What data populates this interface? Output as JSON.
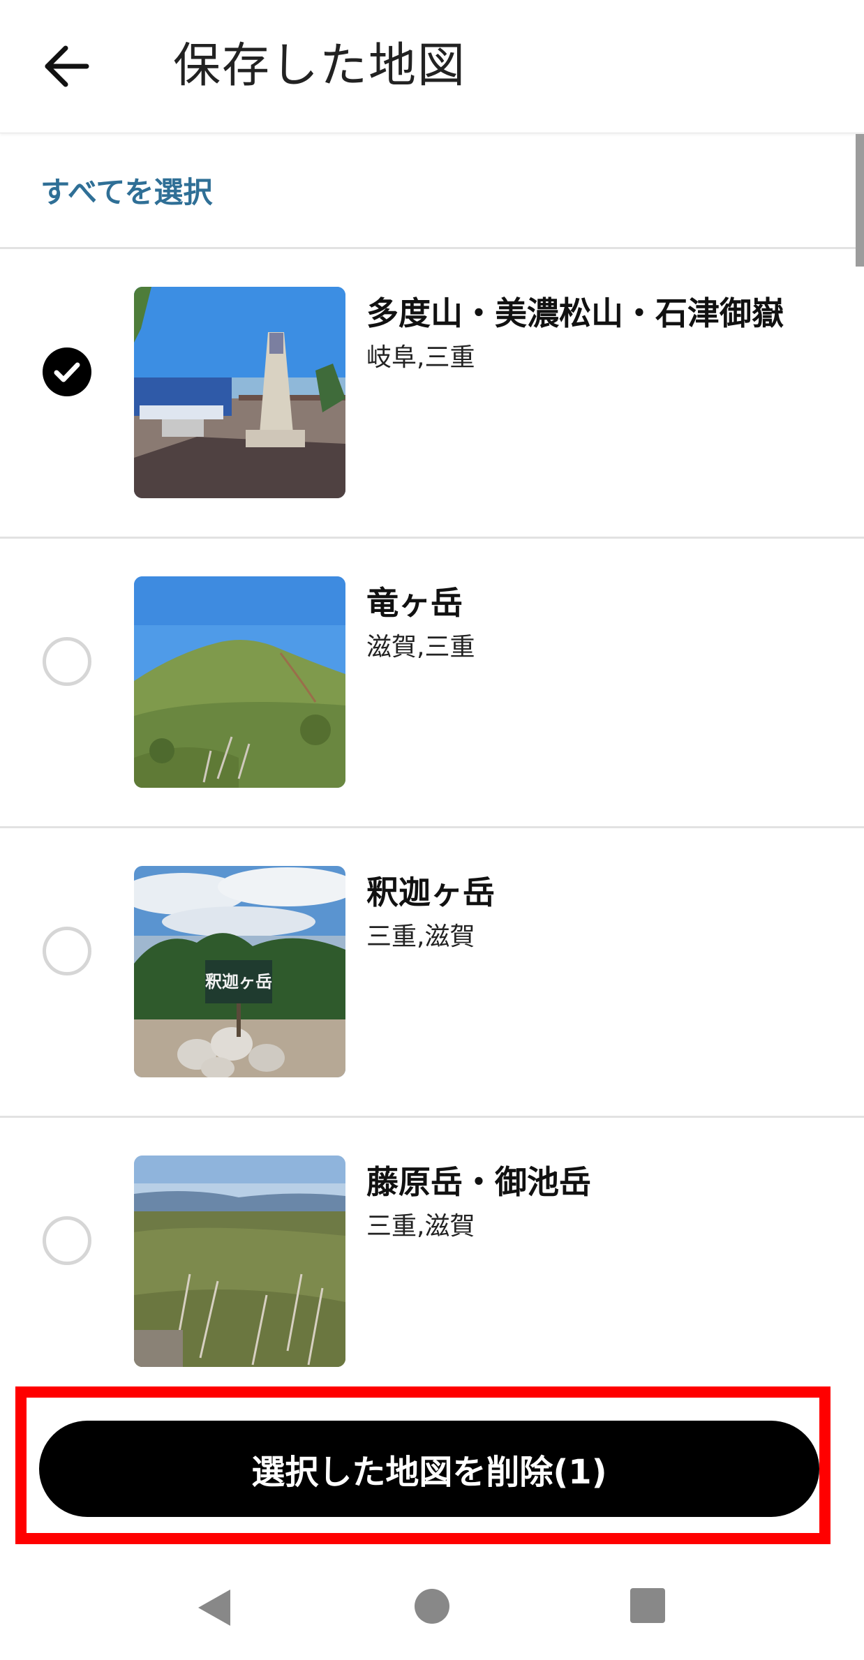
{
  "header": {
    "title": "保存した地図",
    "back_icon": "arrow-left-icon"
  },
  "select_all_label": "すべてを選択",
  "maps": [
    {
      "name": "多度山・美濃松山・石津御嶽",
      "region": "岐阜,三重",
      "selected": true
    },
    {
      "name": "竜ヶ岳",
      "region": "滋賀,三重",
      "selected": false
    },
    {
      "name": "釈迦ヶ岳",
      "region": "三重,滋賀",
      "selected": false
    },
    {
      "name": "藤原岳・御池岳",
      "region": "三重,滋賀",
      "selected": false
    }
  ],
  "photo_sign_text": "釈迦ヶ岳",
  "delete_button_label": "選択した地図を削除(1)",
  "colors": {
    "accent_link": "#2f6f96",
    "highlight_border": "#ff0000",
    "button_bg": "#000000"
  },
  "nav": {
    "back_icon": "triangle-back-icon",
    "home_icon": "circle-home-icon",
    "recent_icon": "square-recents-icon"
  }
}
